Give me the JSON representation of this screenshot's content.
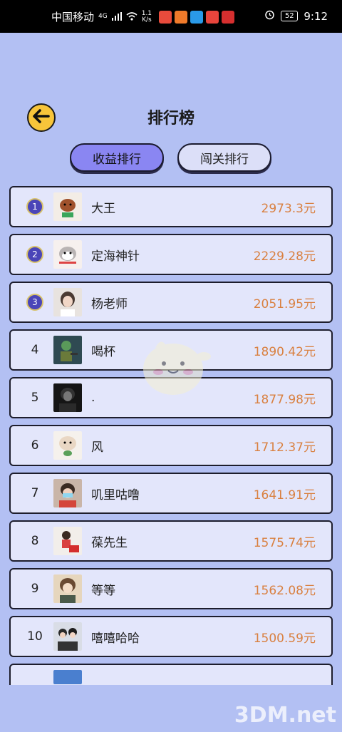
{
  "status_bar": {
    "carrier": "中国移动",
    "network": "4G",
    "speed_top": "1.1",
    "speed_bottom": "K/s",
    "battery": "52",
    "time": "9:12"
  },
  "header": {
    "title": "排行榜"
  },
  "tabs": [
    {
      "label": "收益排行",
      "active": true
    },
    {
      "label": "闯关排行",
      "active": false
    }
  ],
  "ranking": [
    {
      "rank": "1",
      "name": "大王",
      "amount": "2973.3元"
    },
    {
      "rank": "2",
      "name": "定海神针",
      "amount": "2229.28元"
    },
    {
      "rank": "3",
      "name": "杨老师",
      "amount": "2051.95元"
    },
    {
      "rank": "4",
      "name": "喝杯",
      "amount": "1890.42元"
    },
    {
      "rank": "5",
      "name": ".",
      "amount": "1877.98元"
    },
    {
      "rank": "6",
      "name": "风",
      "amount": "1712.37元"
    },
    {
      "rank": "7",
      "name": "叽里咕噜",
      "amount": "1641.91元"
    },
    {
      "rank": "8",
      "name": "葆先生",
      "amount": "1575.74元"
    },
    {
      "rank": "9",
      "name": "等等",
      "amount": "1562.08元"
    },
    {
      "rank": "10",
      "name": "嘻嘻哈哈",
      "amount": "1500.59元"
    }
  ],
  "watermark": "3DM.net",
  "colors": {
    "background": "#b3c0f3",
    "row_bg": "#e3e6fb",
    "amount": "#d98040",
    "active_tab": "#8a86f2",
    "back_button": "#f8c53a",
    "medal": "#4a45b8"
  }
}
